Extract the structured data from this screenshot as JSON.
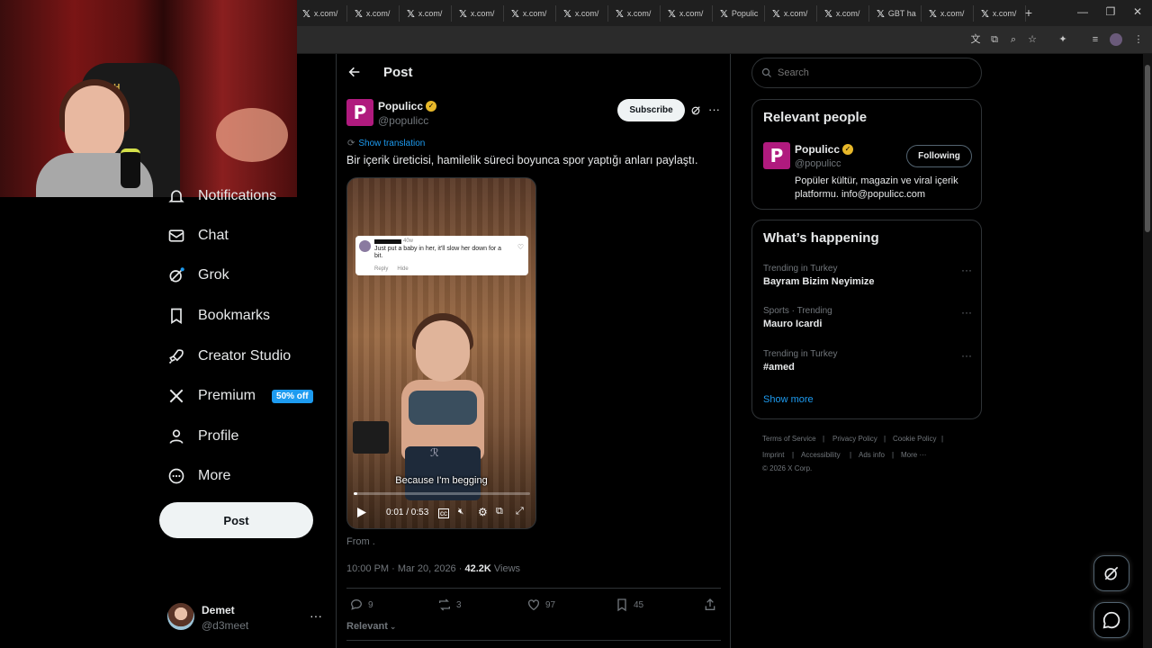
{
  "browser": {
    "tabs": [
      {
        "label": "x.com/",
        "icon": "x-logo-icon"
      },
      {
        "label": "x.com/",
        "icon": "x-logo-icon"
      },
      {
        "label": "x.com/",
        "icon": "x-logo-icon"
      },
      {
        "label": "x.com/",
        "icon": "x-logo-icon"
      },
      {
        "label": "x.com/",
        "icon": "x-logo-icon"
      },
      {
        "label": "x.com/",
        "icon": "x-logo-icon"
      },
      {
        "label": "x.com/",
        "icon": "x-logo-icon"
      },
      {
        "label": "x.com/",
        "icon": "x-logo-icon"
      },
      {
        "label": "Populic",
        "icon": "x-logo-icon"
      },
      {
        "label": "x.com/",
        "icon": "x-logo-icon"
      },
      {
        "label": "x.com/",
        "icon": "x-logo-icon"
      },
      {
        "label": "GBT ha",
        "icon": "x-logo-icon"
      },
      {
        "label": "x.com/",
        "icon": "x-logo-icon"
      },
      {
        "label": "x.com/",
        "icon": "x-logo-icon"
      }
    ],
    "new_tab": "+",
    "minimize": "—",
    "restore": "❐",
    "close": "✕"
  },
  "nav": {
    "notifications_label": "Notifications",
    "chat_label": "Chat",
    "grok_label": "Grok",
    "bookmarks_label": "Bookmarks",
    "creator_studio_label": "Creator Studio",
    "premium_label": "Premium",
    "premium_badge": "50% off",
    "profile_label": "Profile",
    "more_label": "More",
    "post_button": "Post"
  },
  "account": {
    "name": "Demet",
    "handle": "@d3meet",
    "more": "···"
  },
  "header": {
    "back_icon": "arrow-left-icon",
    "title": "Post"
  },
  "tweet": {
    "author_name": "Populicc",
    "author_handle": "@populicc",
    "logo_letter": "P",
    "subscribe_label": "Subscribe",
    "more": "···",
    "show_translation": "Show translation",
    "text": "Bir içerik üreticisi, hamilelik süreci boyunca spor yaptığı anları paylaştı.",
    "video": {
      "comment_time": "40w",
      "comment_text": "Just put a baby in her, it'll slow her down for a bit.",
      "comment_reply": "Reply",
      "comment_hide": "Hide",
      "caption": "Because I'm begging",
      "time": "0:01 / 0:53",
      "progress": 0.02
    },
    "from_label": "From .",
    "timestamp": "10:00 PM · Mar 20, 2026 · ",
    "views_count": "42.2K",
    "views_label": " Views",
    "replies": "9",
    "reposts": "3",
    "likes": "97",
    "bookmarks": "45",
    "sort_label": "Relevant"
  },
  "sidebar": {
    "search_placeholder": "Search",
    "relevant_title": "Relevant people",
    "person": {
      "name": "Populicc",
      "handle": "@populicc",
      "bio": "Popüler kültür, magazin ve viral içerik platformu. info@populicc.com",
      "follow_label": "Following"
    },
    "happening_title": "What’s happening",
    "trends": [
      {
        "meta": "Trending in Turkey",
        "name": "Bayram Bizim Neyimize"
      },
      {
        "meta": "Sports · Trending",
        "name": "Mauro Icardi"
      },
      {
        "meta": "Trending in Turkey",
        "name": "#amed"
      }
    ],
    "show_more": "Show more",
    "footer": {
      "terms": "Terms of Service",
      "privacy": "Privacy Policy",
      "cookie": "Cookie Policy",
      "imprint": "Imprint",
      "accessibility": "Accessibility",
      "ads": "Ads info",
      "more": "More ···",
      "copyright": "© 2026 X Corp."
    }
  },
  "webcam": {
    "chair_logo": "WAH"
  },
  "colors": {
    "accent": "#1d9bf0",
    "brand_populicc": "#b01a7e",
    "verified": "#e8b82a",
    "background": "#000000"
  }
}
